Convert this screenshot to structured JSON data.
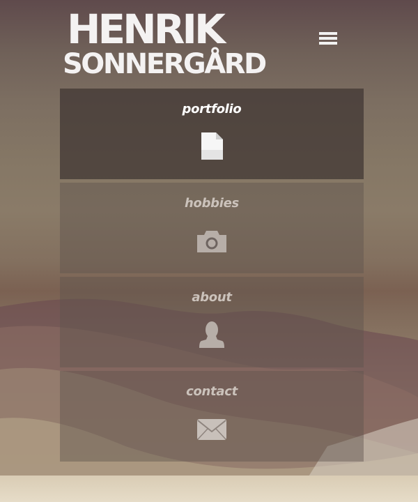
{
  "header": {
    "logo": {
      "line1": "HENRIK",
      "line2": "SONNERGÅRD"
    },
    "menu_icon": "hamburger-menu-icon"
  },
  "nav": {
    "items": [
      {
        "label": "portfolio",
        "icon": "document-icon",
        "active": true
      },
      {
        "label": "hobbies",
        "icon": "camera-icon",
        "active": false
      },
      {
        "label": "about",
        "icon": "person-icon",
        "active": false
      },
      {
        "label": "contact",
        "icon": "envelope-icon",
        "active": false
      }
    ]
  },
  "colors": {
    "active_tile": "#3e3432",
    "active_label": "#ffffff",
    "dim_label": "#cbc2bb",
    "logo": "#f4f2f2"
  }
}
